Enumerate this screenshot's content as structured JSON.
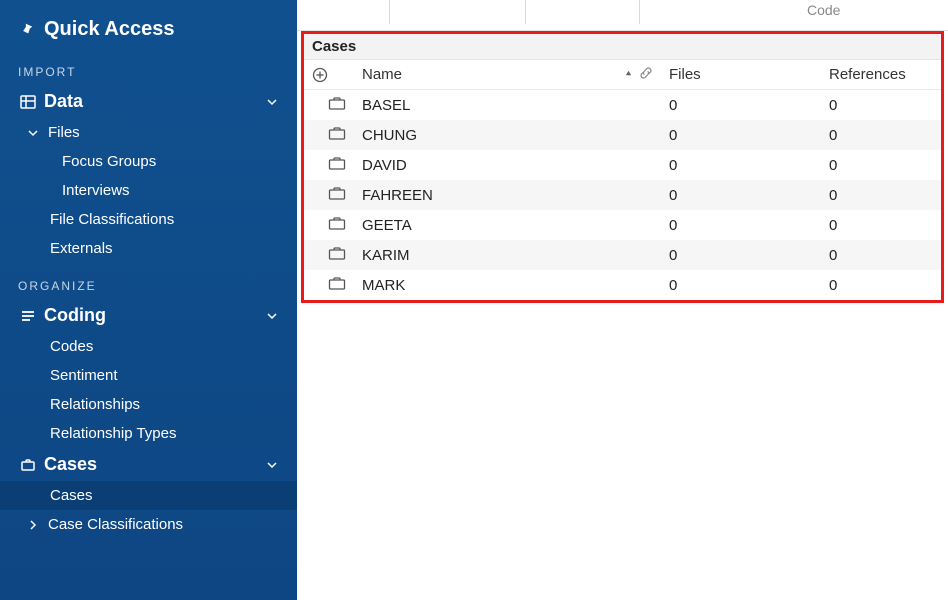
{
  "sidebar": {
    "quick_access": "Quick Access",
    "import_label": "IMPORT",
    "organize_label": "ORGANIZE",
    "data": {
      "label": "Data",
      "files": "Files",
      "focus_groups": "Focus Groups",
      "interviews": "Interviews",
      "file_classifications": "File Classifications",
      "externals": "Externals"
    },
    "coding": {
      "label": "Coding",
      "codes": "Codes",
      "sentiment": "Sentiment",
      "relationships": "Relationships",
      "relationship_types": "Relationship Types"
    },
    "cases": {
      "label": "Cases",
      "cases_item": "Cases",
      "case_classifications": "Case Classifications"
    }
  },
  "top": {
    "code_label": "Code"
  },
  "panel": {
    "title": "Cases",
    "columns": {
      "name": "Name",
      "files": "Files",
      "references": "References"
    },
    "rows": [
      {
        "name": "BASEL",
        "files": 0,
        "references": 0
      },
      {
        "name": "CHUNG",
        "files": 0,
        "references": 0
      },
      {
        "name": "DAVID",
        "files": 0,
        "references": 0
      },
      {
        "name": "FAHREEN",
        "files": 0,
        "references": 0
      },
      {
        "name": "GEETA",
        "files": 0,
        "references": 0
      },
      {
        "name": "KARIM",
        "files": 0,
        "references": 0
      },
      {
        "name": "MARK",
        "files": 0,
        "references": 0
      }
    ]
  }
}
